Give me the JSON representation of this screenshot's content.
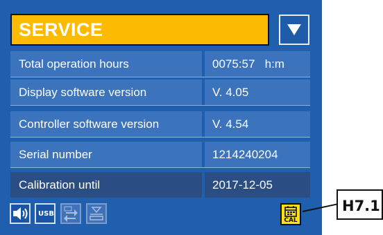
{
  "header": {
    "title": "SERVICE",
    "dropdown_icon": "triangle-down-icon"
  },
  "rows": [
    {
      "label": "Total operation hours",
      "value": "0075:57   h:m"
    },
    {
      "label": "Display software version",
      "value": "V. 4.05"
    },
    {
      "label": "Controller software version",
      "value": "V. 4.54"
    },
    {
      "label": "Serial number",
      "value": "1214240204"
    },
    {
      "label": "Calibration until",
      "value": "2017-12-05"
    }
  ],
  "toolbar": {
    "sound_icon": "speaker-icon",
    "usb_label": "USB",
    "transfer_icon": "data-transfer-icon",
    "level_icon": "level-icon",
    "calendar_icon": "calendar-icon",
    "cal_label": "CAL"
  },
  "callout": {
    "label": "H7.1"
  },
  "colors": {
    "panel": "#1f5fad",
    "header_bar": "#fdbb00",
    "row": "#3c73bd",
    "row_dark": "#2a4e84",
    "cal_button": "#ffe014"
  }
}
